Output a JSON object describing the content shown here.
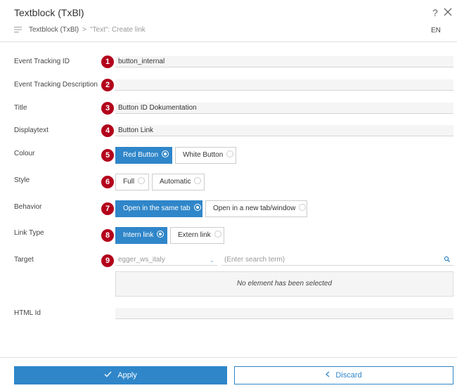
{
  "header": {
    "title": "Textblock (TxBl)",
    "help": "?",
    "breadcrumb_root": "Textblock (TxBl)",
    "breadcrumb_sep": ">",
    "breadcrumb_current": "\"Text\": Create link",
    "language": "EN"
  },
  "form": {
    "event_tracking_id": {
      "label": "Event Tracking ID",
      "badge": "1",
      "value": "button_internal"
    },
    "event_tracking_description": {
      "label": "Event Tracking Description",
      "badge": "2",
      "value": ""
    },
    "title": {
      "label": "Title",
      "badge": "3",
      "value": "Button ID Dokumentation"
    },
    "displaytext": {
      "label": "Displaytext",
      "badge": "4",
      "value": "Button Link"
    },
    "colour": {
      "label": "Colour",
      "badge": "5",
      "options": [
        "Red Button",
        "White Button"
      ],
      "selected": "Red Button"
    },
    "style": {
      "label": "Style",
      "badge": "6",
      "options": [
        "Full",
        "Automatic"
      ],
      "selected": ""
    },
    "behavior": {
      "label": "Behavior",
      "badge": "7",
      "options": [
        "Open in the same tab",
        "Open in a new tab/window"
      ],
      "selected": "Open in the same tab"
    },
    "link_type": {
      "label": "Link Type",
      "badge": "8",
      "options": [
        "Intern link",
        "Extern link"
      ],
      "selected": "Intern link"
    },
    "target": {
      "label": "Target",
      "badge": "9",
      "select_value": "egger_ws_italy",
      "search_placeholder": "(Enter search term)",
      "empty_text": "No element has been selected"
    },
    "html_id": {
      "label": "HTML Id",
      "value": ""
    }
  },
  "footer": {
    "apply_label": "Apply",
    "discard_label": "Discard"
  },
  "colors": {
    "accent": "#2f86c9",
    "badge": "#b3001b"
  },
  "icons": {
    "help": "help-icon",
    "close": "close-icon",
    "menu": "menu-icon",
    "chevron": "chevron-down-icon",
    "search": "search-icon",
    "check": "check-icon",
    "back": "chevron-left-icon"
  }
}
